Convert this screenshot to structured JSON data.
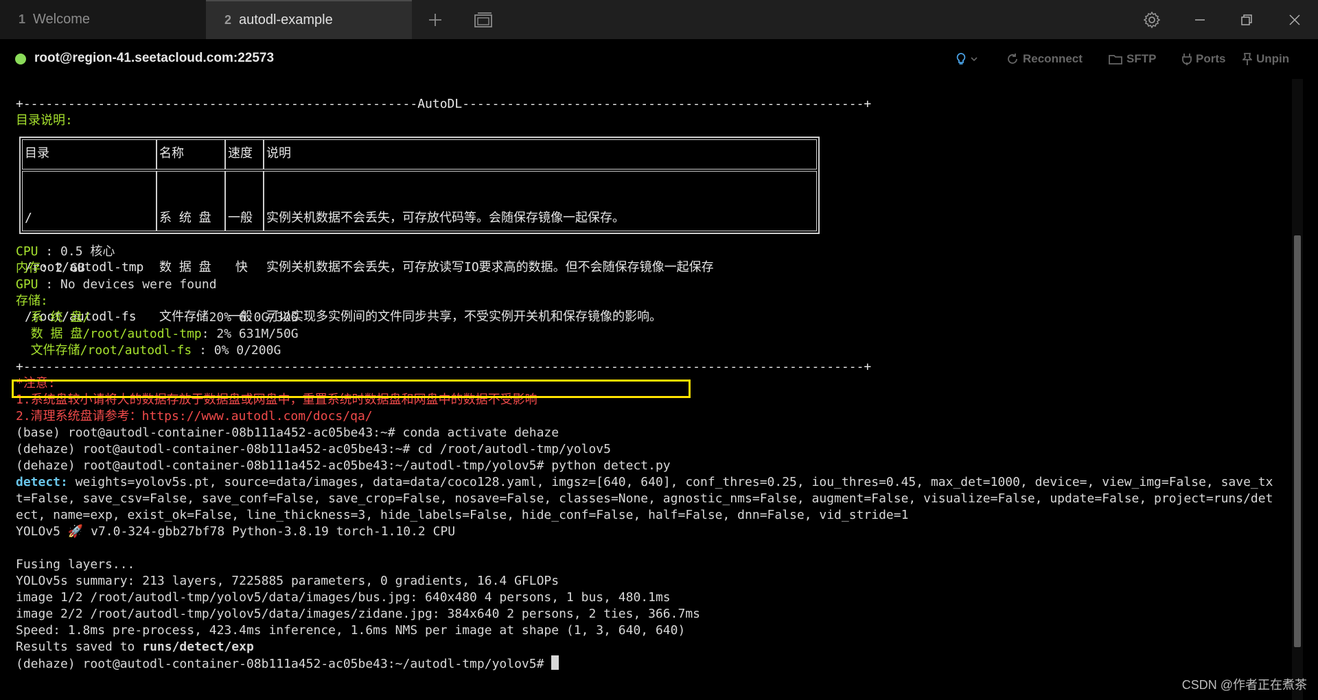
{
  "tabs": [
    {
      "num": "1",
      "label": "Welcome"
    },
    {
      "num": "2",
      "label": "autodl-example"
    }
  ],
  "toolbar_icons": [
    "plus-icon",
    "window-icon",
    "gear-icon",
    "minimize-icon",
    "restore-icon",
    "close-icon"
  ],
  "status": {
    "host": "root@region-41.seetacloud.com:22573",
    "connected_color": "#8bdc5a",
    "reconnect": "Reconnect",
    "sftp": "SFTP",
    "ports": "Ports",
    "unpin": "Unpin"
  },
  "terminal": {
    "border_top": "+-----------------------------------------------------AutoDL------------------------------------------------------+",
    "dir_title": "目录说明:",
    "table": {
      "headers": [
        "目录",
        "名称",
        "速度",
        "说明"
      ],
      "rows": [
        {
          "dir": "/",
          "name": "系 统 盘",
          "speed": "一般",
          "desc": "实例关机数据不会丢失，可存放代码等。会随保存镜像一起保存。"
        },
        {
          "dir": "/root/autodl-tmp",
          "name": "数 据 盘",
          "speed": " 快 ",
          "desc": "实例关机数据不会丢失，可存放读写IO要求高的数据。但不会随保存镜像一起保存"
        },
        {
          "dir": "/root/autodl-fs",
          "name": "文件存储",
          "speed": "一般",
          "desc": "可以实现多实例间的文件同步共享，不受实例开关机和保存镜像的影响。"
        }
      ]
    },
    "cpu_label": "CPU",
    "cpu_value": " : 0.5 核心",
    "mem_label": "内存",
    "mem_value": ": 2 GB",
    "gpu_label": "GPU",
    "gpu_value": " : No devices were found",
    "storage_label": "存储:",
    "storage": [
      {
        "label": "  系 统 盘/              ",
        "value": ": 20% 6.0G/30G"
      },
      {
        "label": "  数 据 盘/root/autodl-tmp",
        "value": ": 2% 631M/50G"
      },
      {
        "label": "  文件存储/root/autodl-fs ",
        "value": ": 0% 0/200G"
      }
    ],
    "border_bottom": "+-----------------------------------------------------------------------------------------------------------------+",
    "notice_title": "*注意:",
    "notice_1": "1.系统盘较小请将大的数据存放于数据盘或网盘中，重置系统时数据盘和网盘中的数据不受影响",
    "notice_2": "2.清理系统盘请参考：https://www.autodl.com/docs/qa/",
    "cmd_1": "(base) root@autodl-container-08b111a452-ac05be43:~# conda activate dehaze",
    "cmd_2": "(dehaze) root@autodl-container-08b111a452-ac05be43:~# cd /root/autodl-tmp/yolov5",
    "cmd_3": "(dehaze) root@autodl-container-08b111a452-ac05be43:~/autodl-tmp/yolov5# python detect.py",
    "detect_label": "detect:",
    "detect_1": " weights=yolov5s.pt, source=data/images, data=data/coco128.yaml, imgsz=[640, 640], conf_thres=0.25, iou_thres=0.45, max_det=1000, device=, view_img=False, save_tx",
    "detect_2": "t=False, save_csv=False, save_conf=False, save_crop=False, nosave=False, classes=None, agnostic_nms=False, augment=False, visualize=False, update=False, project=runs/det",
    "detect_3": "ect, name=exp, exist_ok=False, line_thickness=3, hide_labels=False, hide_conf=False, half=False, dnn=False, vid_stride=1",
    "yolo_version": "YOLOv5 🚀 v7.0-324-gbb27bf78 Python-3.8.19 torch-1.10.2 CPU",
    "fusing": "Fusing layers...",
    "summary": "YOLOv5s summary: 213 layers, 7225885 parameters, 0 gradients, 16.4 GFLOPs",
    "image_1": "image 1/2 /root/autodl-tmp/yolov5/data/images/bus.jpg: 640x480 4 persons, 1 bus, 480.1ms",
    "image_2": "image 2/2 /root/autodl-tmp/yolov5/data/images/zidane.jpg: 384x640 2 persons, 2 ties, 366.7ms",
    "speed": "Speed: 1.8ms pre-process, 423.4ms inference, 1.6ms NMS per image at shape (1, 3, 640, 640)",
    "results_prefix": "Results saved to ",
    "results_path": "runs/detect/exp",
    "prompt": "(dehaze) root@autodl-container-08b111a452-ac05be43:~/autodl-tmp/yolov5# "
  },
  "watermark": "CSDN @作者正在煮茶"
}
